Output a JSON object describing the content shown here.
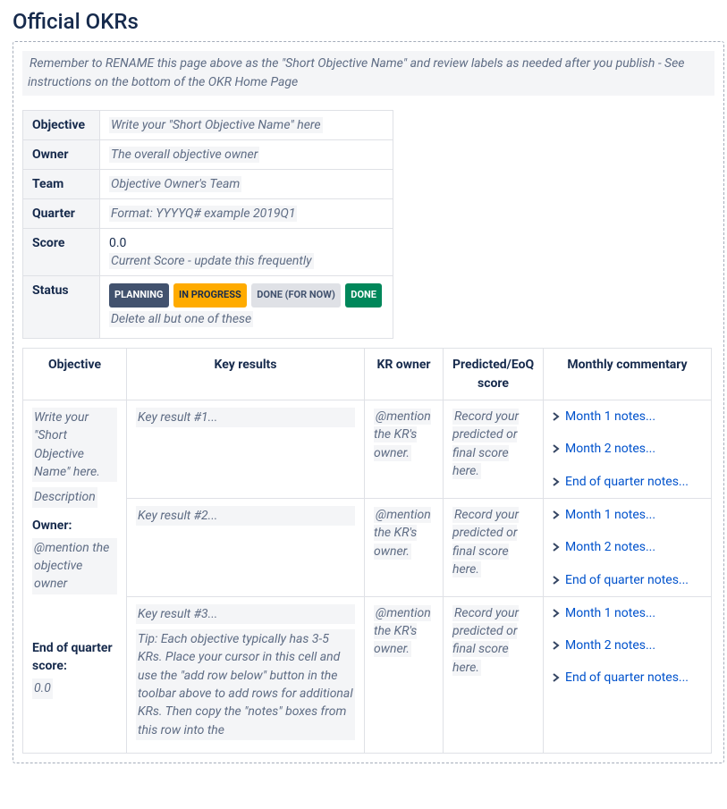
{
  "title": "Official OKRs",
  "reminder": "Remember to RENAME this page above as the \"Short Objective Name\" and review labels as needed after you publish - See instructions on the bottom of the OKR Home Page",
  "meta": {
    "labels": {
      "objective": "Objective",
      "owner": "Owner",
      "team": "Team",
      "quarter": "Quarter",
      "score": "Score",
      "status": "Status"
    },
    "objective_ph": "Write your \"Short Objective Name\" here",
    "owner_ph": "The overall objective owner",
    "team_ph": "Objective Owner's Team",
    "quarter_ph": "Format: YYYYQ# example 2019Q1",
    "score_value": "0.0",
    "score_ph": "Current Score - update this frequently",
    "status": {
      "planning": "PLANNING",
      "inprogress": "IN PROGRESS",
      "donefornow": "DONE (FOR NOW)",
      "done": "DONE",
      "hint": "Delete all but one of these"
    }
  },
  "kr": {
    "headers": {
      "objective": "Objective",
      "key_results": "Key results",
      "kr_owner": "KR owner",
      "score": "Predicted/EoQ score",
      "commentary": "Monthly commentary"
    },
    "objective_cell": {
      "name_ph": "Write your \"Short Objective Name\" here.",
      "desc_ph": "Description",
      "owner_label": "Owner:",
      "owner_ph": "@mention the objective owner",
      "eoq_label": "End of quarter score:",
      "eoq_value_ph": "0.0"
    },
    "rows": [
      {
        "kr_ph": "Key result #1...",
        "tip": null,
        "owner_ph": "@mention the KR's owner.",
        "score_ph": "Record your predicted or final score here.",
        "notes": [
          "Month 1 notes...",
          "Month 2 notes...",
          "End of quarter notes..."
        ]
      },
      {
        "kr_ph": "Key result #2...",
        "tip": null,
        "owner_ph": "@mention the KR's owner.",
        "score_ph": "Record your predicted or final score here.",
        "notes": [
          "Month 1 notes...",
          "Month 2 notes...",
          "End of quarter notes..."
        ]
      },
      {
        "kr_ph": "Key result #3...",
        "tip": "Tip: Each objective typically has 3-5 KRs. Place your cursor in this cell and use the \"add row below\" button in the toolbar above to add rows for additional KRs. Then copy the \"notes\" boxes from this row into the",
        "owner_ph": "@mention the KR's owner.",
        "score_ph": "Record your predicted or final score here.",
        "notes": [
          "Month 1 notes...",
          "Month 2 notes...",
          "End of quarter notes..."
        ]
      }
    ]
  }
}
